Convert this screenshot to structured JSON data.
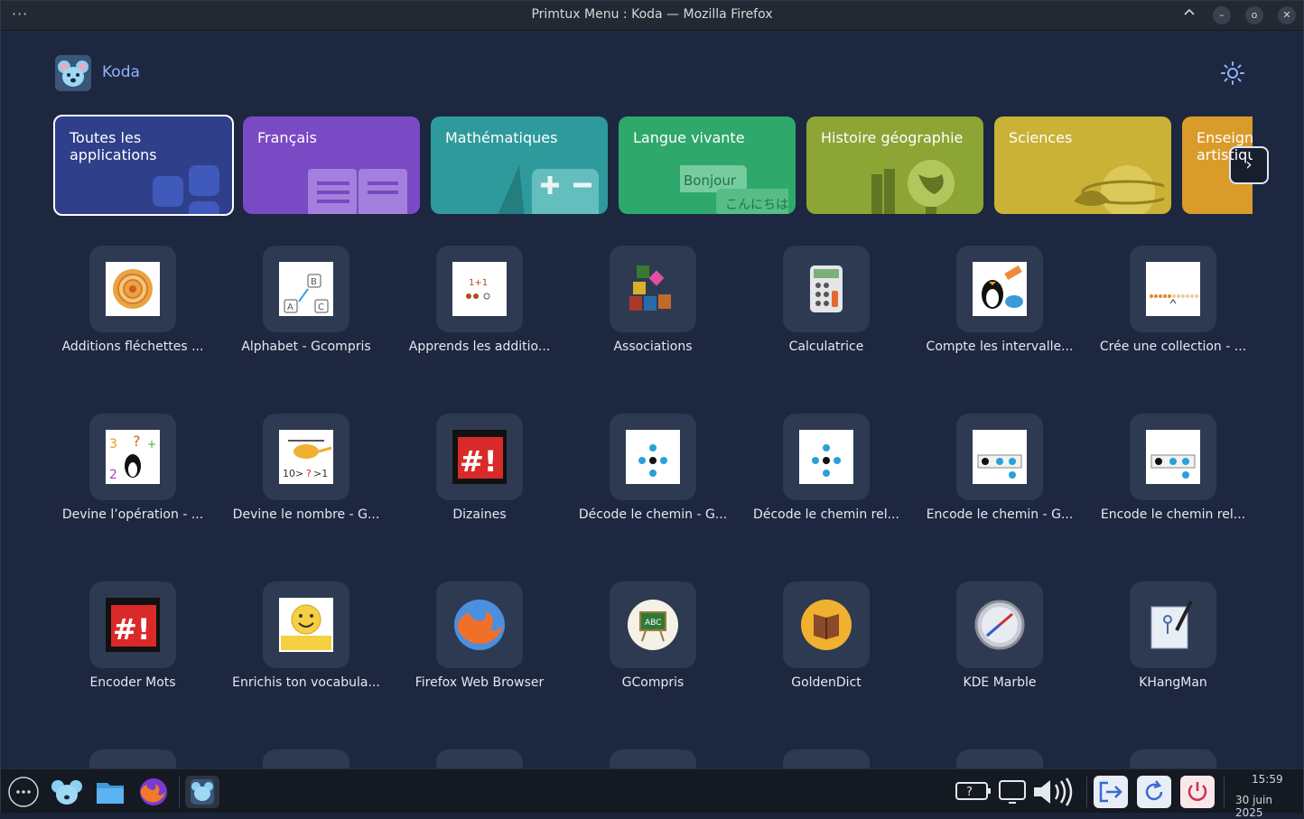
{
  "window": {
    "title": "Primtux Menu : Koda — Mozilla Firefox",
    "menu_dots": "···",
    "controls": [
      "chevron-up-icon",
      "minimize-icon",
      "maximize-icon",
      "close-icon"
    ]
  },
  "header": {
    "brand": "Koda",
    "logo_icon": "koala-icon",
    "theme_icon": "sun-icon"
  },
  "categories": [
    {
      "label": "Toutes les applications",
      "color": "#2f3f8a",
      "selected": true
    },
    {
      "label": "Français",
      "color": "#7a49c4"
    },
    {
      "label": "Mathématiques",
      "color": "#2f9a9c"
    },
    {
      "label": "Langue vivante",
      "color": "#2fa86b"
    },
    {
      "label": "Histoire géographie",
      "color": "#8da535"
    },
    {
      "label": "Sciences",
      "color": "#c9b235"
    },
    {
      "label": "Enseignement artistique",
      "color": "#d99b2a"
    }
  ],
  "category_art_text": {
    "bonjour": "Bonjour",
    "konnichiwa": "こんにちは"
  },
  "next_button": "›",
  "apps": [
    {
      "label": "Additions fléchettes ...",
      "icon": "target-icon"
    },
    {
      "label": "Alphabet - Gcompris",
      "icon": "letters-icon"
    },
    {
      "label": "Apprends les additio...",
      "icon": "dots-addition-icon"
    },
    {
      "label": "Associations",
      "icon": "cubes-icon"
    },
    {
      "label": "Calculatrice",
      "icon": "calculator-icon"
    },
    {
      "label": "Compte les intervalle...",
      "icon": "tux-fish-icon"
    },
    {
      "label": "Crée une collection - ...",
      "icon": "bead-line-icon"
    },
    {
      "label": "Devine l’opération - ...",
      "icon": "tux-numbers-icon"
    },
    {
      "label": "Devine le nombre - G...",
      "icon": "helicopter-icon"
    },
    {
      "label": "Dizaines",
      "icon": "hash-exclaim-icon"
    },
    {
      "label": "Décode le chemin - G...",
      "icon": "path-arrows-icon"
    },
    {
      "label": "Décode le chemin rel...",
      "icon": "path-arrows-icon"
    },
    {
      "label": "Encode le chemin - G...",
      "icon": "path-grid-icon"
    },
    {
      "label": "Encode le chemin rel...",
      "icon": "path-grid-icon"
    },
    {
      "label": "Encoder Mots",
      "icon": "hash-exclaim-icon"
    },
    {
      "label": "Enrichis ton vocabula...",
      "icon": "smiley-icon"
    },
    {
      "label": "Firefox Web Browser",
      "icon": "firefox-icon"
    },
    {
      "label": "GCompris",
      "icon": "gcompris-icon"
    },
    {
      "label": "GoldenDict",
      "icon": "book-icon"
    },
    {
      "label": "KDE Marble",
      "icon": "globe-icon"
    },
    {
      "label": "KHangMan",
      "icon": "hangman-icon"
    }
  ],
  "taskbar": {
    "launcher_icon": "app-menu-icon",
    "pinned": [
      "koala-icon",
      "files-icon",
      "firefox-icon",
      "koala-icon"
    ],
    "tray": [
      "help-icon",
      "display-icon",
      "volume-icon",
      "logout-icon",
      "restart-icon",
      "power-icon"
    ],
    "time": "15:59",
    "date": "30 juin 2025"
  }
}
